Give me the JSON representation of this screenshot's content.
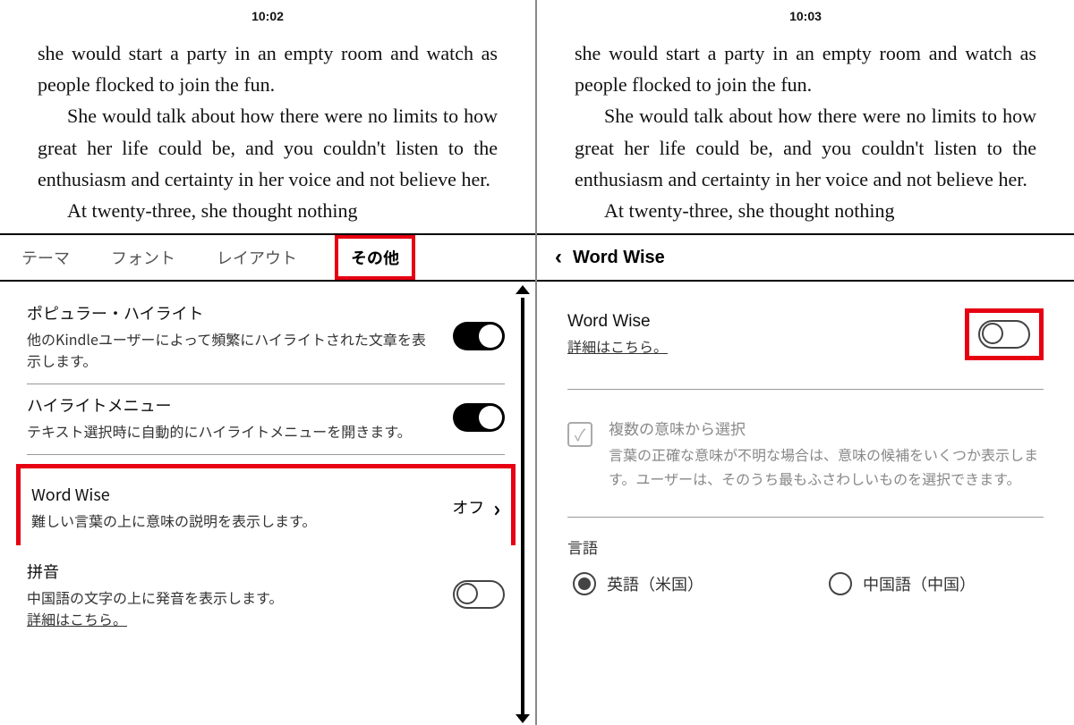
{
  "left": {
    "clock": "10:02",
    "para1": "she would start a party in an empty room and watch as people flocked to join the fun.",
    "para2": "She would talk about how there were no limits to how great her life could be, and you couldn't listen to the enthusiasm and certainty in her voice and not believe her.",
    "para3": "At twenty-three, she thought nothing",
    "tabs": {
      "theme": "テーマ",
      "font": "フォント",
      "layout": "レイアウト",
      "other": "その他"
    },
    "popular": {
      "title": "ポピュラー・ハイライト",
      "desc": "他のKindleユーザーによって頻繁にハイライトされた文章を表示します。"
    },
    "highlight": {
      "title": "ハイライトメニュー",
      "desc": "テキスト選択時に自動的にハイライトメニューを開きます。"
    },
    "wordwise": {
      "title": "Word Wise",
      "desc": "難しい言葉の上に意味の説明を表示します。",
      "value": "オフ"
    },
    "pinyin": {
      "title": "拼音",
      "desc": "中国語の文字の上に発音を表示します。",
      "link": "詳細はこちら。"
    }
  },
  "right": {
    "clock": "10:03",
    "para1": "she would start a party in an empty room and watch as people flocked to join the fun.",
    "para2": "She would talk about how there were no limits to how great her life could be, and you couldn't listen to the enthusiasm and certainty in her voice and not believe her.",
    "para3": "At twenty-three, she thought nothing",
    "header": "Word Wise",
    "ww": {
      "title": "Word Wise",
      "link": "詳細はこちら。"
    },
    "check": {
      "title": "複数の意味から選択",
      "desc": "言葉の正確な意味が不明な場合は、意味の候補をいくつか表示します。ユーザーは、そのうち最もふさわしいものを選択できます。"
    },
    "lang": {
      "label": "言語",
      "en": "英語（米国）",
      "zh": "中国語（中国）"
    }
  }
}
